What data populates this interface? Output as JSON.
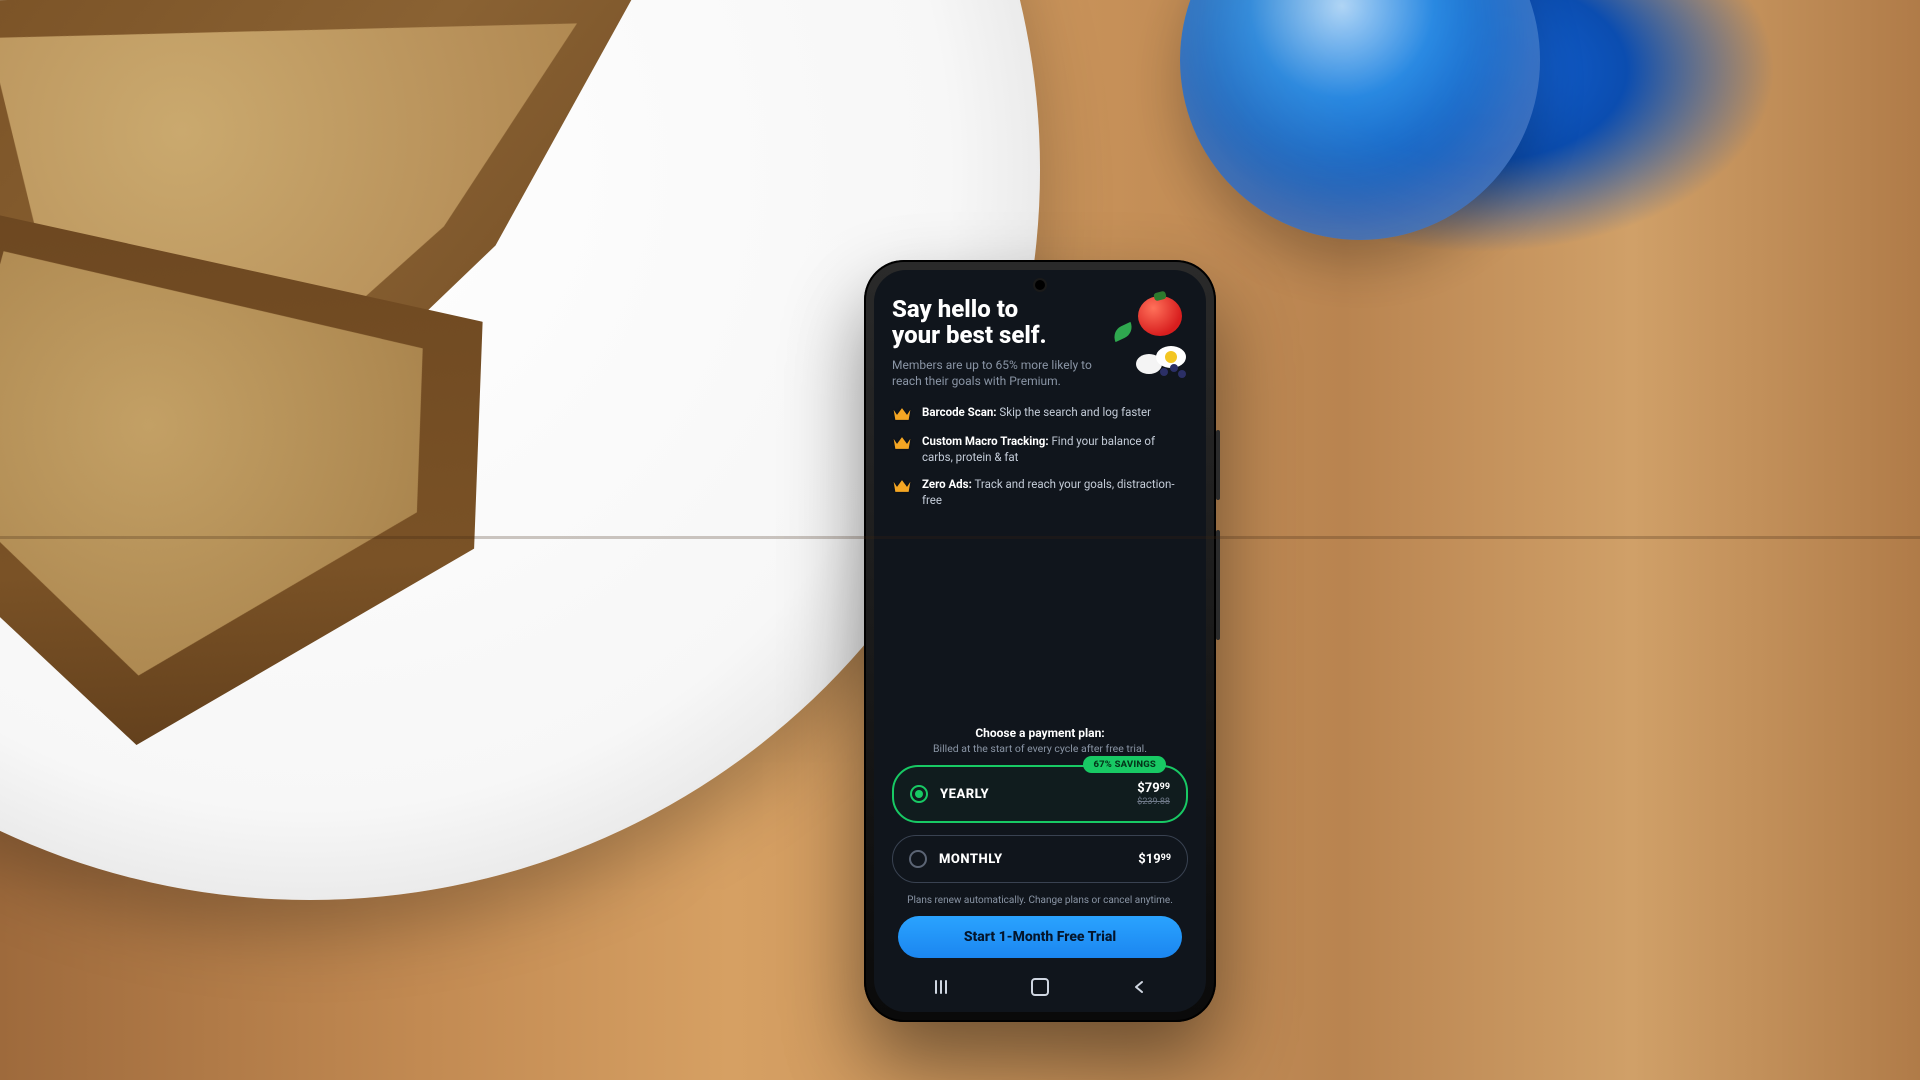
{
  "hero": {
    "title_line1": "Say hello to",
    "title_line2": "your best self.",
    "subtitle": "Members are up to 65% more likely to reach their goals with Premium."
  },
  "features": [
    {
      "title": "Barcode Scan:",
      "desc": "Skip the search and log faster"
    },
    {
      "title": "Custom Macro Tracking:",
      "desc": "Find your balance of carbs, protein & fat"
    },
    {
      "title": "Zero Ads:",
      "desc": "Track and reach your goals, distraction-free"
    }
  ],
  "plan_section": {
    "heading": "Choose a payment plan:",
    "subheading": "Billed at the start of every cycle after free trial."
  },
  "plans": {
    "yearly": {
      "label": "YEARLY",
      "price_main": "$79",
      "price_cents": "99",
      "price_strike": "$239.88",
      "badge": "67% SAVINGS",
      "selected": true
    },
    "monthly": {
      "label": "MONTHLY",
      "price_main": "$19",
      "price_cents": "99",
      "selected": false
    }
  },
  "fineprint": "Plans renew automatically. Change plans or cancel anytime.",
  "cta_label": "Start 1-Month Free Trial",
  "colors": {
    "accent_green": "#18c964",
    "accent_blue": "#1e90ff",
    "crown": "#f5a623"
  }
}
